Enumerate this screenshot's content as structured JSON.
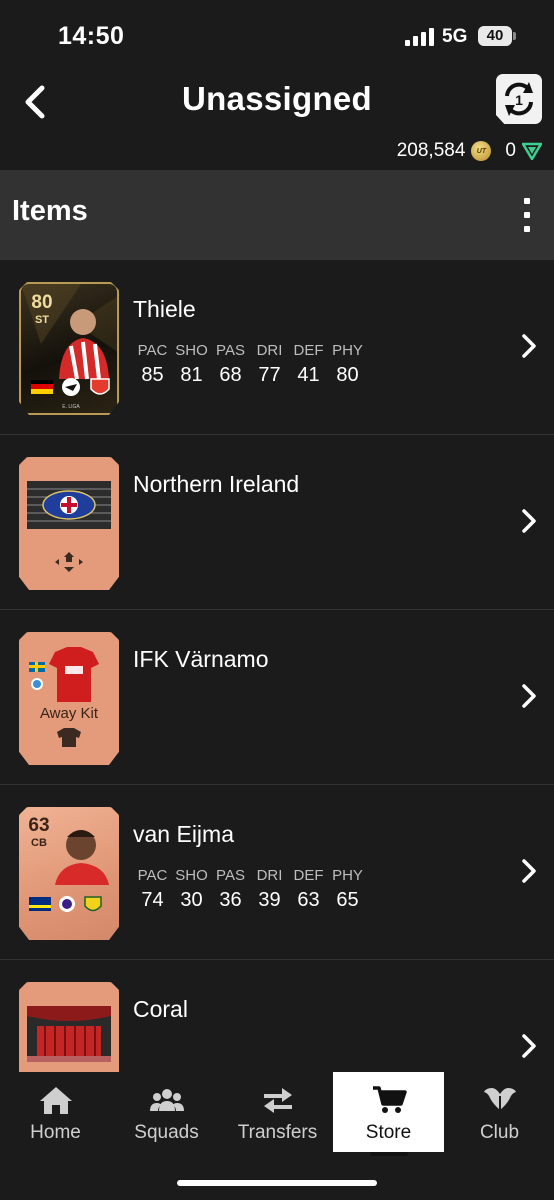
{
  "status": {
    "time": "14:50",
    "network": "5G",
    "battery": "40"
  },
  "header": {
    "title": "Unassigned",
    "coins": "208,584",
    "coin_symbol": "UT",
    "points": "0"
  },
  "section": {
    "title": "Items"
  },
  "items": [
    {
      "name": "Thiele",
      "type": "player",
      "rating": "80",
      "position": "ST",
      "stats": [
        {
          "label": "PAC",
          "value": "85"
        },
        {
          "label": "SHO",
          "value": "81"
        },
        {
          "label": "PAS",
          "value": "68"
        },
        {
          "label": "DRI",
          "value": "77"
        },
        {
          "label": "DEF",
          "value": "41"
        },
        {
          "label": "PHY",
          "value": "80"
        }
      ]
    },
    {
      "name": "Northern Ireland",
      "type": "stadium-tifo"
    },
    {
      "name": "IFK Värnamo",
      "type": "kit",
      "kit_label": "Away Kit"
    },
    {
      "name": "van Eijma",
      "type": "player",
      "rating": "63",
      "position": "CB",
      "stats": [
        {
          "label": "PAC",
          "value": "74"
        },
        {
          "label": "SHO",
          "value": "30"
        },
        {
          "label": "PAS",
          "value": "36"
        },
        {
          "label": "DRI",
          "value": "39"
        },
        {
          "label": "DEF",
          "value": "63"
        },
        {
          "label": "PHY",
          "value": "65"
        }
      ]
    },
    {
      "name": "Coral",
      "type": "stadium-theme"
    }
  ],
  "tabs": [
    {
      "label": "Home",
      "icon": "home-icon"
    },
    {
      "label": "Squads",
      "icon": "squads-icon"
    },
    {
      "label": "Transfers",
      "icon": "transfers-icon"
    },
    {
      "label": "Store",
      "icon": "store-icon",
      "active": true
    },
    {
      "label": "Club",
      "icon": "club-icon"
    }
  ],
  "colors": {
    "background": "#1b1b1b",
    "section": "#323232",
    "bronze": "#e0987a",
    "gold_card": "#2a2415"
  }
}
